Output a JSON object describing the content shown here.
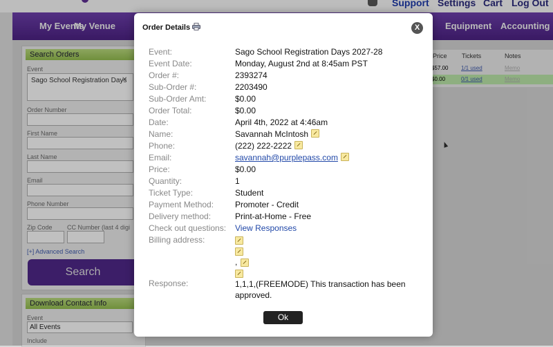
{
  "topbar": {
    "support": "Support",
    "settings": "Settings",
    "cart": "Cart",
    "logout": "Log Out"
  },
  "nav": {
    "items": [
      "My Events",
      "My Venue",
      "Equipment",
      "Accounting"
    ]
  },
  "search_panel": {
    "title": "Search Orders",
    "event_label": "Event",
    "event_chip": "Sago School Registration Days",
    "order_number_label": "Order Number",
    "first_name_label": "First Name",
    "last_name_label": "Last Name",
    "email_label": "Email",
    "phone_label": "Phone Number",
    "zip_label": "Zip Code",
    "cc_label": "CC Number (last 4 digi",
    "advanced_link": "[+] Advanced Search",
    "search_button": "Search"
  },
  "contact_panel": {
    "title": "Download Contact Info",
    "event_label": "Event",
    "event_select": "All Events",
    "include_label": "Include"
  },
  "results_table": {
    "headers": [
      "Price",
      "Tickets",
      "Notes"
    ],
    "rows": [
      {
        "price": "$57.00",
        "tickets": "1/1 used",
        "notes": "Memo"
      },
      {
        "price": "$0.00",
        "tickets": "0/1 used",
        "notes": "Memo"
      }
    ]
  },
  "modal": {
    "title": "Order Details",
    "close_label": "X",
    "ok_label": "Ok",
    "fields": [
      {
        "label": "Event:",
        "value": "Sago School Registration Days 2027-28"
      },
      {
        "label": "Event Date:",
        "value": "Monday, August 2nd at 8:45am PST"
      },
      {
        "label": "Order #:",
        "value": "2393274"
      },
      {
        "label": "Sub-Order #:",
        "value": "2203490"
      },
      {
        "label": "Sub-Order Amt:",
        "value": "$0.00"
      },
      {
        "label": "Order Total:",
        "value": "$0.00"
      },
      {
        "label": "Date:",
        "value": "April 4th, 2022 at 4:46am"
      },
      {
        "label": "Name:",
        "value": "Savannah McIntosh"
      },
      {
        "label": "Phone:",
        "value": "(222) 222-2222"
      },
      {
        "label": "Email:",
        "value": "savannah@purplepass.com"
      },
      {
        "label": "Price:",
        "value": "$0.00"
      },
      {
        "label": "Quantity:",
        "value": "1"
      },
      {
        "label": "Ticket Type:",
        "value": "Student"
      },
      {
        "label": "Payment Method:",
        "value": "Promoter - Credit"
      },
      {
        "label": "Delivery method:",
        "value": "Print-at-Home - Free"
      },
      {
        "label": "Check out questions:",
        "value": "View Responses"
      },
      {
        "label": "Billing address:",
        "value": ""
      }
    ],
    "billing_comma": ",",
    "response_label": "Response:",
    "response_value": "1,1,1,(FREEMODE) This transaction has been approved."
  }
}
